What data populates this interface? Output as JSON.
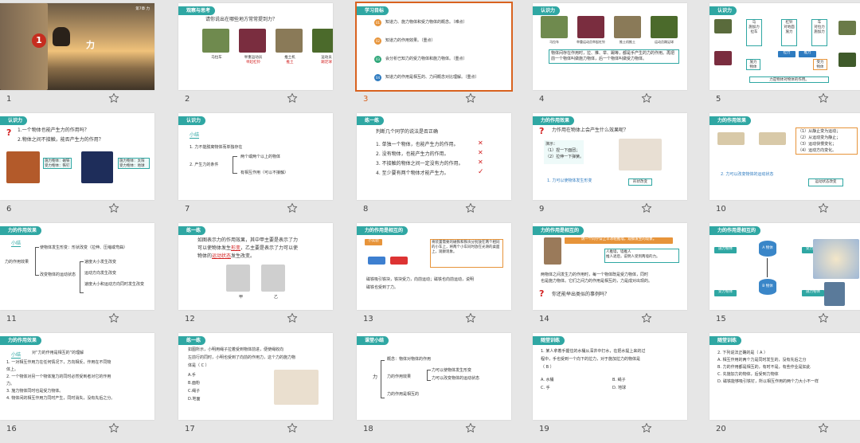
{
  "slides": [
    {
      "n": "1",
      "title": "力",
      "tag": "第7章 力"
    },
    {
      "n": "2",
      "header": "观察与思考",
      "q": "请你说出在哪些地方常常提到力？",
      "caps": [
        [
          "马拉车",
          ""
        ],
        [
          "举重运动员",
          "举起杠铃"
        ],
        [
          "推土机",
          "推土"
        ],
        [
          "运动员",
          "踢足球"
        ]
      ]
    },
    {
      "n": "3",
      "header": "学习目标",
      "goals": [
        "知道力、施力物体和受力物体的概念。（难点）",
        "知道力的作用效果。（重点）",
        "会分析已知力的受力物体和施力物体。（重点）",
        "知道力的作用是相互的、力间概念对比理解。（重点）"
      ],
      "goal_nums": [
        "01",
        "02",
        "03",
        "04"
      ]
    },
    {
      "n": "4",
      "header": "认识力",
      "caps": [
        "马拉车",
        "举重运动员举起杠铃",
        "推土机推土",
        "运动员踢足球"
      ],
      "note1": "物体间存在作用时，拉、推、举、踢等，都是手产生的力的作用。再把",
      "note2": "前一个物体叫做施力物体，后一个物体叫做受力物体。"
    },
    {
      "n": "5",
      "header": "认识力",
      "b1": "马\n施加力\n拉车",
      "b2": "杠铃\n对地面\n施力",
      "b3": "车\n对拉力\n施加力",
      "mid": [
        "拉力",
        "推力"
      ],
      "p1": "施力\n物体",
      "p2": "受力\n物体",
      "foot": "力是物体对物体的作用。"
    },
    {
      "n": "6",
      "header": "认识力",
      "q1": "1.一个物体也能产生力的作用吗？",
      "q2": "2.物体之间不接触，能否产生力的作用？",
      "bx1": "施力物体：磁铁\n受力物体：铁钉",
      "bx2": "施力物体：太阳\n受力物体：地球"
    },
    {
      "n": "7",
      "header": "认识力",
      "sub": "小结",
      "l1": "1. 力不能脱离物体而单独存在",
      "l2": "2. 产生力的条件",
      "r1": "两个或两个以上的物体",
      "r2": "有相互作用（可以不接触）"
    },
    {
      "n": "8",
      "header": "练一练",
      "q": "判断几个同学的说法是否正确",
      "items": [
        "1. 单独一个物体，也能产生力的作用。",
        "2. 没有物体，也能产生力的作用。",
        "3. 不接触的物体之间一定没有力的作用。",
        "4. 至少要有两个物体才能产生力。"
      ],
      "marks": [
        "✕",
        "✕",
        "✕",
        "✓"
      ]
    },
    {
      "n": "9",
      "header": "力的作用效果",
      "q": "力作用在物体上会产生什么效果呢？",
      "demo": "演示：",
      "d1": "（1）捏一下面团；",
      "d2": "（2）拉伸一下弹簧。",
      "c1": "1. 力可以使物体发生形变",
      "tag": "形状改变"
    },
    {
      "n": "10",
      "header": "力的作用效果",
      "r": [
        "（1）从静止变为运动；",
        "（2）从运动变为静止；",
        "（3）运动快慢变化；",
        "（4）运动方向变化。"
      ],
      "c2": "2. 力可以改变物体的运动状态",
      "tag": "运动状态改变"
    },
    {
      "n": "11",
      "header": "力的作用效果",
      "sub": "小结",
      "root": "力的作用效果",
      "b1": "使物体发生形变：形状改变（拉伸、压缩或弯曲）",
      "b2": "改变物体的运动状态",
      "s": [
        "速度大小发生改变",
        "运动方向发生改变",
        "速度大小和运动方向同时发生改变"
      ]
    },
    {
      "n": "12",
      "header": "练一练",
      "q1": "如图表示力的作用效果，其中甲主要是表示了力",
      "q2": "可以使物体发生",
      "a1": "形变",
      "q3": "，乙主要是表示了力可以使",
      "q4": "物体的",
      "a2": "运动状态",
      "q5": "发生改变。",
      "labels": [
        "甲",
        "乙"
      ]
    },
    {
      "n": "13",
      "header": "力的作用是相互的",
      "tag": "小实验",
      "box": "将装置需要的磁铁和铁块分别放在两个相同的小车上，将两个小车同时放在光滑的桌面上，观察现象。",
      "f1": "磁铁吸引铁块，铁块受力，向前运动；磁铁也向前运动，说明",
      "f2": "磁铁也受到了力。"
    },
    {
      "n": "14",
      "header": "力的作用是相互的",
      "t1": "请一个同学穿上旱冰鞋推墙，观察发生的现象。",
      "b": "人推墙，墙推人\n推人退后，说明人受到两墙的力。",
      "p1": "两物体之间发生力的作用时，每一个物体既是受力物体，同时",
      "p2": "也是施力物体。它们之间力的作用是相互的，力是成对出现的。",
      "q": "你还能举出类似的事例吗？"
    },
    {
      "n": "15",
      "header": "力的作用是相互的",
      "labels": [
        "施力物体",
        "A 物体",
        "受力物体",
        "受力物体",
        "B 物体",
        "施力物体"
      ]
    },
    {
      "n": "16",
      "header": "力的作用效果",
      "sub": "小结",
      "t": "对“力的作用是相互的”的理解",
      "l": [
        "1. 一对相互作用力在任何情况下，方向相反，作用在不同物",
        "体上。",
        "2. 一个物体对另一个物体施力的同时必然受到者对它的作用",
        "力。",
        "3. 施力物体同时也是受力物体。",
        "4. 物体间的相互作用力同时产生，同时消失，没有先后之分。"
      ]
    },
    {
      "n": "17",
      "header": "练一练",
      "l": [
        "如图所示，小明用绳子拉着受到物体前进，便使绳收向",
        "左前行的同时，小明也受到了向前的作用力，这个力的施力物",
        "体是（ C ）"
      ],
      "opts": [
        "A.手",
        "B.面粉",
        "C.绳子",
        "D.地面"
      ]
    },
    {
      "n": "18",
      "header": "课堂小结",
      "root": "力",
      "b": [
        "概念：物体对物体的作用",
        "力的作用效果",
        "力的作用是相互的"
      ],
      "s": [
        "力可以使物体发生形变",
        "力可以改变物体的运动状态"
      ]
    },
    {
      "n": "19",
      "header": "随堂训练",
      "l": [
        "1. 某人拿着手握住的水桶从深井中打水，在把水提上来的过",
        "程中，手也受到一个向下的拉力，对于施加拉力的物体是",
        "（ B ）"
      ],
      "opts": [
        "A. 水桶",
        "B. 绳子",
        "C. 手",
        "D. 地球"
      ]
    },
    {
      "n": "20",
      "header": "随堂训练",
      "l": [
        "2. 下列说法正确的是（ A ）",
        "A. 相互作用的两个力是同时发生的，没有先后之分",
        "B. 力的作用都是相互的，有时不是，有些作业是如此",
        "C. 先施加力的物体，后受到力物体",
        "D. 磁铁能够吸引铁钉，所以相互作用的两个力大小不一样"
      ]
    }
  ]
}
